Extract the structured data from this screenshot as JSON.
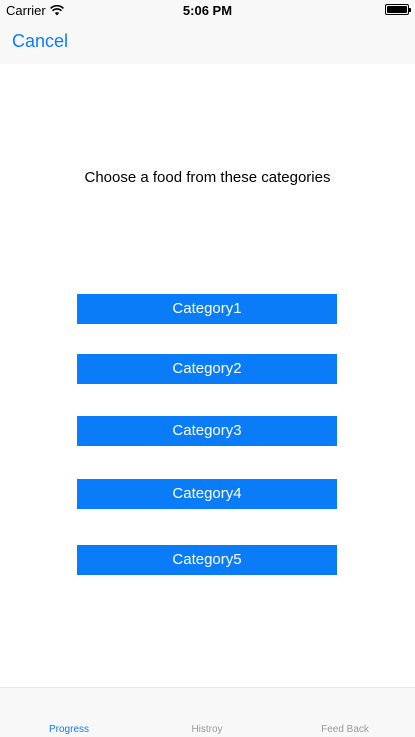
{
  "status_bar": {
    "carrier": "Carrier",
    "time": "5:06 PM"
  },
  "nav": {
    "cancel_label": "Cancel"
  },
  "main": {
    "prompt": "Choose a food from these categories",
    "categories": [
      {
        "label": "Category1"
      },
      {
        "label": "Category2"
      },
      {
        "label": "Category3"
      },
      {
        "label": "Category4"
      },
      {
        "label": "Category5"
      }
    ]
  },
  "tab_bar": {
    "tabs": [
      {
        "label": "Progress",
        "active": true
      },
      {
        "label": "Histroy",
        "active": false
      },
      {
        "label": "Feed Back",
        "active": false
      }
    ]
  },
  "colors": {
    "accent": "#0a7cf7",
    "bar_background": "#f8f8f8",
    "inactive_tab": "#9a9a9a"
  }
}
